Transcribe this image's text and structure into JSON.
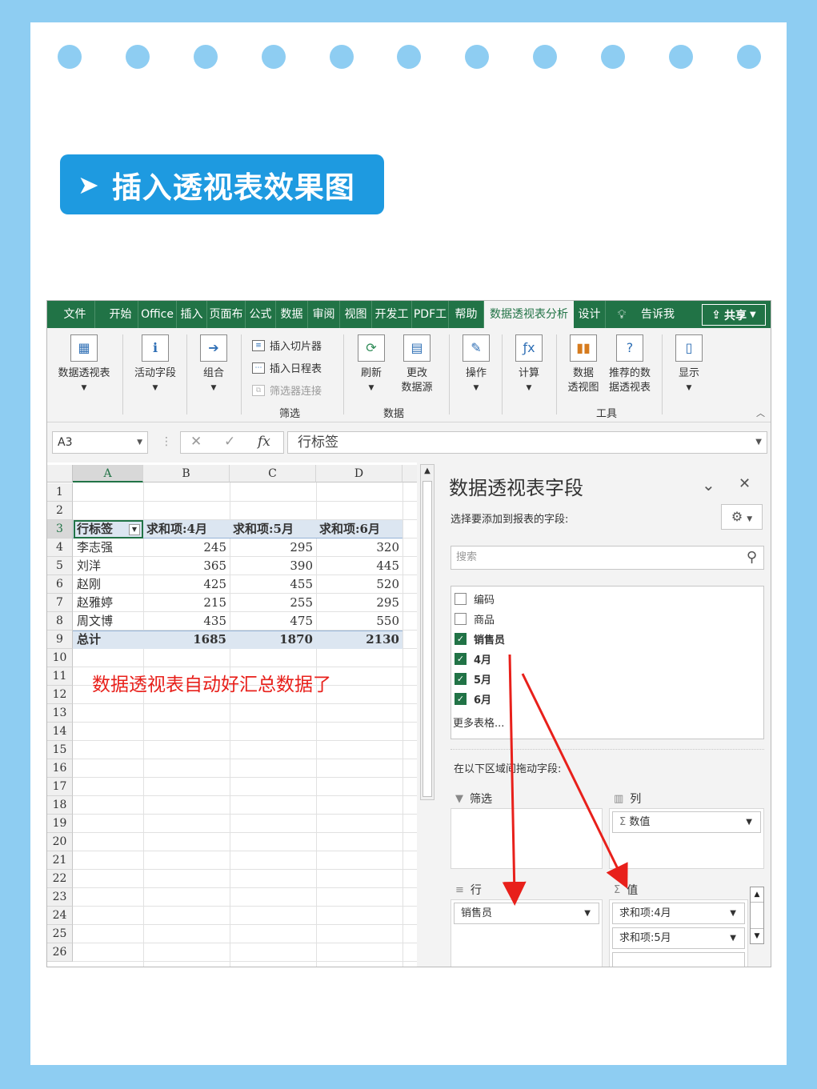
{
  "banner": {
    "arrow": "➤",
    "title": "插入透视表效果图"
  },
  "excel": {
    "tabs": [
      "文件",
      "开始",
      "Office",
      "插入",
      "页面布",
      "公式",
      "数据",
      "审阅",
      "视图",
      "开发工",
      "PDF工",
      "帮助",
      "数据透视表分析",
      "设计",
      "告诉我"
    ],
    "share_label": "共享",
    "ribbon": {
      "pivot_table": "数据透视表",
      "active_field": "活动字段",
      "group": "组合",
      "insert_slicer": "插入切片器",
      "insert_timeline": "插入日程表",
      "filter_connections": "筛选器连接",
      "filter_group": "筛选",
      "refresh": "刷新",
      "change_source_1": "更改",
      "change_source_2": "数据源",
      "data_group": "数据",
      "actions": "操作",
      "calculations": "计算",
      "pivot_chart_1": "数据",
      "pivot_chart_2": "透视图",
      "recommended_1": "推荐的数",
      "recommended_2": "据透视表",
      "tools_group": "工具",
      "show": "显示"
    },
    "formula": {
      "namebox": "A3",
      "fx": "fx",
      "value": "行标签"
    },
    "columns": [
      "A",
      "B",
      "C",
      "D"
    ],
    "rows": [
      "1",
      "2",
      "3",
      "4",
      "5",
      "6",
      "7",
      "8",
      "9",
      "10",
      "11",
      "12",
      "13",
      "14",
      "15",
      "16",
      "17",
      "18",
      "19",
      "20",
      "21",
      "22",
      "23",
      "24",
      "25",
      "26"
    ],
    "pivot": {
      "headers": [
        "行标签",
        "求和项:4月",
        "求和项:5月",
        "求和项:6月"
      ],
      "data": [
        [
          "李志强",
          "245",
          "295",
          "320"
        ],
        [
          "刘洋",
          "365",
          "390",
          "445"
        ],
        [
          "赵刚",
          "425",
          "455",
          "520"
        ],
        [
          "赵雅婷",
          "215",
          "255",
          "295"
        ],
        [
          "周文博",
          "435",
          "475",
          "550"
        ]
      ],
      "total": [
        "总计",
        "1685",
        "1870",
        "2130"
      ]
    },
    "annotation": "数据透视表自动好汇总数据了"
  },
  "pane": {
    "title": "数据透视表字段",
    "subtitle": "选择要添加到报表的字段:",
    "search_placeholder": "搜索",
    "fields": [
      {
        "label": "编码",
        "checked": false
      },
      {
        "label": "商品",
        "checked": false
      },
      {
        "label": "销售员",
        "checked": true
      },
      {
        "label": "4月",
        "checked": true
      },
      {
        "label": "5月",
        "checked": true
      },
      {
        "label": "6月",
        "checked": true
      }
    ],
    "more_tables": "更多表格...",
    "drag_label": "在以下区域间拖动字段:",
    "areas": {
      "filter": "筛选",
      "columns": "列",
      "rows": "行",
      "values": "值",
      "columns_item": "数值",
      "rows_item": "销售员",
      "values_items": [
        "求和项:4月",
        "求和项:5月"
      ]
    }
  },
  "colors": {
    "excel_green": "#217346",
    "banner_blue": "#1e9ae0",
    "arrow_red": "#e8201b",
    "bg_blue": "#8ecdf2"
  }
}
